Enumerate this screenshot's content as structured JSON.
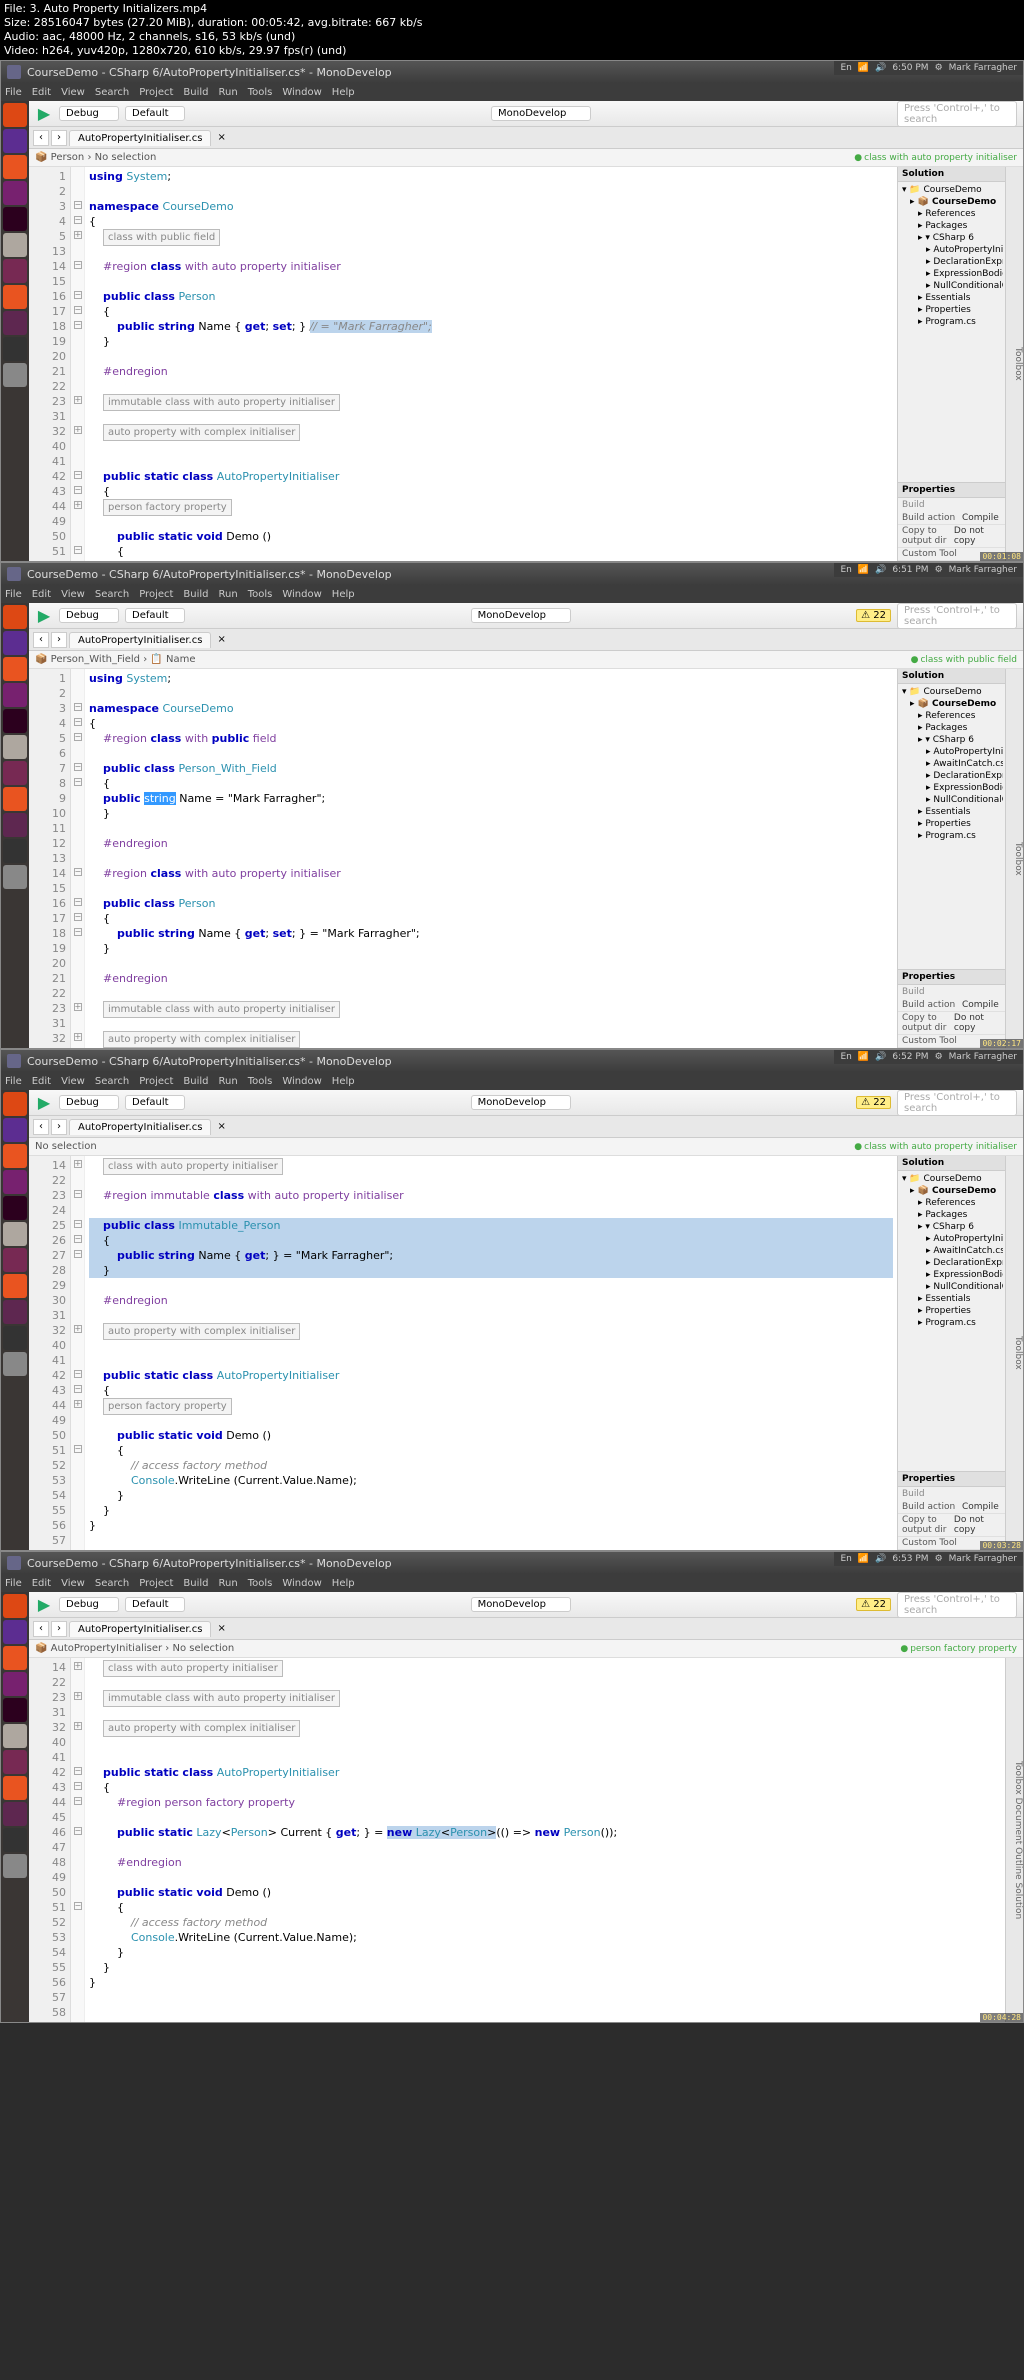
{
  "meta": {
    "file": "File: 3. Auto Property Initializers.mp4",
    "size": "Size: 28516047 bytes (27.20 MiB), duration: 00:05:42, avg.bitrate: 667 kb/s",
    "audio": "Audio: aac, 48000 Hz, 2 channels, s16, 53 kb/s (und)",
    "video": "Video: h264, yuv420p, 1280x720, 610 kb/s, 29.97 fps(r) (und)"
  },
  "common": {
    "window_title": "CourseDemo - CSharp 6/AutoPropertyInitialiser.cs* - MonoDevelop",
    "menu": [
      "File",
      "Edit",
      "View",
      "Search",
      "Project",
      "Build",
      "Run",
      "Tools",
      "Window",
      "Help"
    ],
    "config": "Debug",
    "platform": "Default",
    "target": "MonoDevelop",
    "search_ph": "Press 'Control+,' to search",
    "tab1": "AutoPropertyInitialiser.cs",
    "solution_hdr": "Solution",
    "properties_hdr": "Properties",
    "user": "Mark Farragher",
    "build_cat": "Build",
    "prop_build_action_k": "Build action",
    "prop_build_action_v": "Compile",
    "prop_copy_k": "Copy to output dir",
    "prop_copy_v": "Do not copy",
    "prop_custom_k": "Custom Tool"
  },
  "shot1": {
    "time": "6:50 PM",
    "crumb1": "Person",
    "crumb2": "No selection",
    "badge": "class with auto property initialiser",
    "timestamp": "00:01:08",
    "tree": {
      "root": "CourseDemo",
      "proj": "CourseDemo",
      "refs": "References",
      "pkgs": "Packages",
      "fold": "CSharp 6",
      "files": [
        "AutoPropertyInitialise",
        "DeclarationExpressions.",
        "ExpressionBodiedFuncti",
        "NullConditionalOperato"
      ],
      "ess": "Essentials",
      "props": "Properties",
      "prog": "Program.cs"
    },
    "lines": [
      {
        "n": "1",
        "t": "using System;"
      },
      {
        "n": "2",
        "t": ""
      },
      {
        "n": "3",
        "t": "namespace CourseDemo"
      },
      {
        "n": "4",
        "t": "{"
      },
      {
        "n": "5",
        "fold": "class with public field"
      },
      {
        "n": "13",
        "t": ""
      },
      {
        "n": "14",
        "t": "    #region class with auto property initialiser"
      },
      {
        "n": "15",
        "t": ""
      },
      {
        "n": "16",
        "t": "    public class Person"
      },
      {
        "n": "17",
        "t": "    {"
      },
      {
        "n": "18",
        "t": "        public string Name { get; set; } // = \"Mark Farragher\";"
      },
      {
        "n": "19",
        "t": "    }"
      },
      {
        "n": "20",
        "t": ""
      },
      {
        "n": "21",
        "t": "    #endregion"
      },
      {
        "n": "22",
        "t": ""
      },
      {
        "n": "23",
        "fold": "immutable class with auto property initialiser"
      },
      {
        "n": "31",
        "t": ""
      },
      {
        "n": "32",
        "fold": "auto property with complex initialiser"
      },
      {
        "n": "40",
        "t": ""
      },
      {
        "n": "41",
        "t": ""
      },
      {
        "n": "42",
        "t": "    public static class AutoPropertyInitialiser"
      },
      {
        "n": "43",
        "t": "    {"
      },
      {
        "n": "44",
        "fold": "person factory property"
      },
      {
        "n": "49",
        "t": ""
      },
      {
        "n": "50",
        "t": "        public static void Demo ()"
      },
      {
        "n": "51",
        "t": "        {"
      }
    ]
  },
  "shot2": {
    "time": "6:51 PM",
    "crumb1": "Person_With_Field",
    "crumb2": "Name",
    "badge": "class with public field",
    "timestamp": "00:02:17",
    "tree": {
      "root": "CourseDemo",
      "proj": "CourseDemo",
      "refs": "References",
      "pkgs": "Packages",
      "fold": "CSharp 6",
      "files": [
        "AutoPropertyInitialise",
        "AwaitInCatch.cs",
        "DeclarationExpressions.",
        "ExpressionBodiedFuncti",
        "NullConditionalOperato"
      ],
      "ess": "Essentials",
      "props": "Properties",
      "prog": "Program.cs"
    },
    "lines": [
      {
        "n": "1",
        "t": "using System;"
      },
      {
        "n": "2",
        "t": ""
      },
      {
        "n": "3",
        "t": "namespace CourseDemo"
      },
      {
        "n": "4",
        "t": "{"
      },
      {
        "n": "5",
        "t": "    #region class with public field"
      },
      {
        "n": "6",
        "t": ""
      },
      {
        "n": "7",
        "t": "    public class Person_With_Field"
      },
      {
        "n": "8",
        "t": "    {"
      },
      {
        "n": "9",
        "t": "        public string Name = \"Mark Farragher\";"
      },
      {
        "n": "10",
        "t": "    }"
      },
      {
        "n": "11",
        "t": ""
      },
      {
        "n": "12",
        "t": "    #endregion"
      },
      {
        "n": "13",
        "t": ""
      },
      {
        "n": "14",
        "t": "    #region class with auto property initialiser"
      },
      {
        "n": "15",
        "t": ""
      },
      {
        "n": "16",
        "t": "    public class Person"
      },
      {
        "n": "17",
        "t": "    {"
      },
      {
        "n": "18",
        "t": "        public string Name { get; set; } = \"Mark Farragher\";"
      },
      {
        "n": "19",
        "t": "    }"
      },
      {
        "n": "20",
        "t": ""
      },
      {
        "n": "21",
        "t": "    #endregion"
      },
      {
        "n": "22",
        "t": ""
      },
      {
        "n": "23",
        "fold": "immutable class with auto property initialiser"
      },
      {
        "n": "31",
        "t": ""
      },
      {
        "n": "32",
        "fold": "auto property with complex initialiser"
      }
    ]
  },
  "shot3": {
    "time": "6:52 PM",
    "crumb": "No selection",
    "badge": "class with auto property initialiser",
    "timestamp": "00:03:28",
    "tree": {
      "root": "CourseDemo",
      "proj": "CourseDemo",
      "refs": "References",
      "pkgs": "Packages",
      "fold": "CSharp 6",
      "files": [
        "AutoPropertyInitialise",
        "AwaitInCatch.cs",
        "DeclarationExpressions.",
        "ExpressionBodiedFuncti",
        "NullConditionalOperato"
      ],
      "ess": "Essentials",
      "props": "Properties",
      "prog": "Program.cs"
    },
    "lines": [
      {
        "n": "14",
        "fold": "class with auto property initialiser"
      },
      {
        "n": "22",
        "t": ""
      },
      {
        "n": "23",
        "t": "    #region immutable class with auto property initialiser"
      },
      {
        "n": "24",
        "t": ""
      },
      {
        "n": "25",
        "t": "    public class Immutable_Person",
        "hl": true
      },
      {
        "n": "26",
        "t": "    {",
        "hl": true
      },
      {
        "n": "27",
        "t": "        public string Name { get; } = \"Mark Farragher\";",
        "hl": true
      },
      {
        "n": "28",
        "t": "    }",
        "hl": true
      },
      {
        "n": "29",
        "t": ""
      },
      {
        "n": "30",
        "t": "    #endregion"
      },
      {
        "n": "31",
        "t": ""
      },
      {
        "n": "32",
        "fold": "auto property with complex initialiser"
      },
      {
        "n": "40",
        "t": ""
      },
      {
        "n": "41",
        "t": ""
      },
      {
        "n": "42",
        "t": "    public static class AutoPropertyInitialiser"
      },
      {
        "n": "43",
        "t": "    {"
      },
      {
        "n": "44",
        "fold": "person factory property"
      },
      {
        "n": "49",
        "t": ""
      },
      {
        "n": "50",
        "t": "        public static void Demo ()"
      },
      {
        "n": "51",
        "t": "        {"
      },
      {
        "n": "52",
        "t": "            // access factory method"
      },
      {
        "n": "53",
        "t": "            Console.WriteLine (Current.Value.Name);"
      },
      {
        "n": "54",
        "t": "        }"
      },
      {
        "n": "55",
        "t": "    }"
      },
      {
        "n": "56",
        "t": "}"
      },
      {
        "n": "57",
        "t": ""
      }
    ]
  },
  "shot4": {
    "time": "6:53 PM",
    "crumb1": "AutoPropertyInitialiser",
    "crumb2": "No selection",
    "badge": "person factory property",
    "timestamp": "00:04:28",
    "right_tabs": [
      "Toolbox",
      "Document Outline",
      "Solution"
    ],
    "lines": [
      {
        "n": "14",
        "fold": "class with auto property initialiser"
      },
      {
        "n": "22",
        "t": ""
      },
      {
        "n": "23",
        "fold": "immutable class with auto property initialiser"
      },
      {
        "n": "31",
        "t": ""
      },
      {
        "n": "32",
        "fold": "auto property with complex initialiser"
      },
      {
        "n": "40",
        "t": ""
      },
      {
        "n": "41",
        "t": ""
      },
      {
        "n": "42",
        "t": "    public static class AutoPropertyInitialiser"
      },
      {
        "n": "43",
        "t": "    {"
      },
      {
        "n": "44",
        "t": "        #region person factory property"
      },
      {
        "n": "45",
        "t": ""
      },
      {
        "n": "46",
        "t": "        public static Lazy<Person> Current { get; } = new Lazy<Person>(() => new Person());"
      },
      {
        "n": "47",
        "t": ""
      },
      {
        "n": "48",
        "t": "        #endregion"
      },
      {
        "n": "49",
        "t": ""
      },
      {
        "n": "50",
        "t": "        public static void Demo ()"
      },
      {
        "n": "51",
        "t": "        {"
      },
      {
        "n": "52",
        "t": "            // access factory method"
      },
      {
        "n": "53",
        "t": "            Console.WriteLine (Current.Value.Name);"
      },
      {
        "n": "54",
        "t": "        }"
      },
      {
        "n": "55",
        "t": "    }"
      },
      {
        "n": "56",
        "t": "}"
      },
      {
        "n": "57",
        "t": ""
      },
      {
        "n": "58",
        "t": ""
      }
    ]
  }
}
